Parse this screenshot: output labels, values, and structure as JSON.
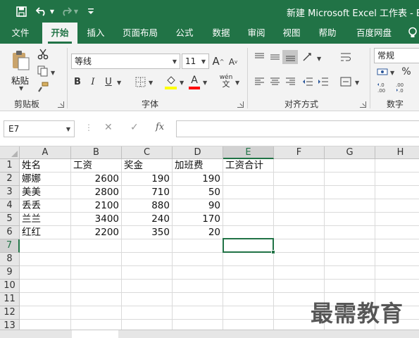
{
  "title_bar": {
    "title": "新建 Microsoft Excel 工作表 - Ex"
  },
  "tabs": [
    {
      "label": "文件",
      "active": false
    },
    {
      "label": "开始",
      "active": true
    },
    {
      "label": "插入",
      "active": false
    },
    {
      "label": "页面布局",
      "active": false
    },
    {
      "label": "公式",
      "active": false
    },
    {
      "label": "数据",
      "active": false
    },
    {
      "label": "审阅",
      "active": false
    },
    {
      "label": "视图",
      "active": false
    },
    {
      "label": "帮助",
      "active": false
    },
    {
      "label": "百度网盘",
      "active": false
    }
  ],
  "ribbon": {
    "clipboard": {
      "paste_label": "粘贴",
      "group_label": "剪贴板"
    },
    "font": {
      "font_name": "等线",
      "font_size": "11",
      "group_label": "字体",
      "bold": "B",
      "italic": "I",
      "underline": "U",
      "grow": "A",
      "shrink": "A",
      "wen": "wén"
    },
    "alignment": {
      "group_label": "对齐方式"
    },
    "number": {
      "format": "常规",
      "group_label": "数字",
      "percent": "%"
    },
    "colors": {
      "accent": "#217346",
      "highlight": "#ffff00",
      "font_color": "#ff0000"
    }
  },
  "formula_bar": {
    "name_box": "E7",
    "fx": "fx",
    "formula": ""
  },
  "sheet": {
    "columns": [
      "A",
      "B",
      "C",
      "D",
      "E",
      "F",
      "G",
      "H"
    ],
    "selected_column": "E",
    "rows": [
      "1",
      "2",
      "3",
      "4",
      "5",
      "6",
      "7",
      "8",
      "9",
      "10",
      "11",
      "12",
      "13"
    ],
    "selected_row": "7",
    "selected_cell": "E7",
    "cells": [
      [
        "姓名",
        "工资",
        "奖金",
        "加班费",
        "工资合计",
        "",
        "",
        ""
      ],
      [
        "娜娜",
        "2600",
        "190",
        "190",
        "",
        "",
        "",
        ""
      ],
      [
        "美美",
        "2800",
        "710",
        "50",
        "",
        "",
        "",
        ""
      ],
      [
        "丢丢",
        "2100",
        "880",
        "90",
        "",
        "",
        "",
        ""
      ],
      [
        "兰兰",
        "3400",
        "240",
        "170",
        "",
        "",
        "",
        ""
      ],
      [
        "红红",
        "2200",
        "350",
        "20",
        "",
        "",
        "",
        ""
      ]
    ]
  },
  "watermark": "最需教育"
}
